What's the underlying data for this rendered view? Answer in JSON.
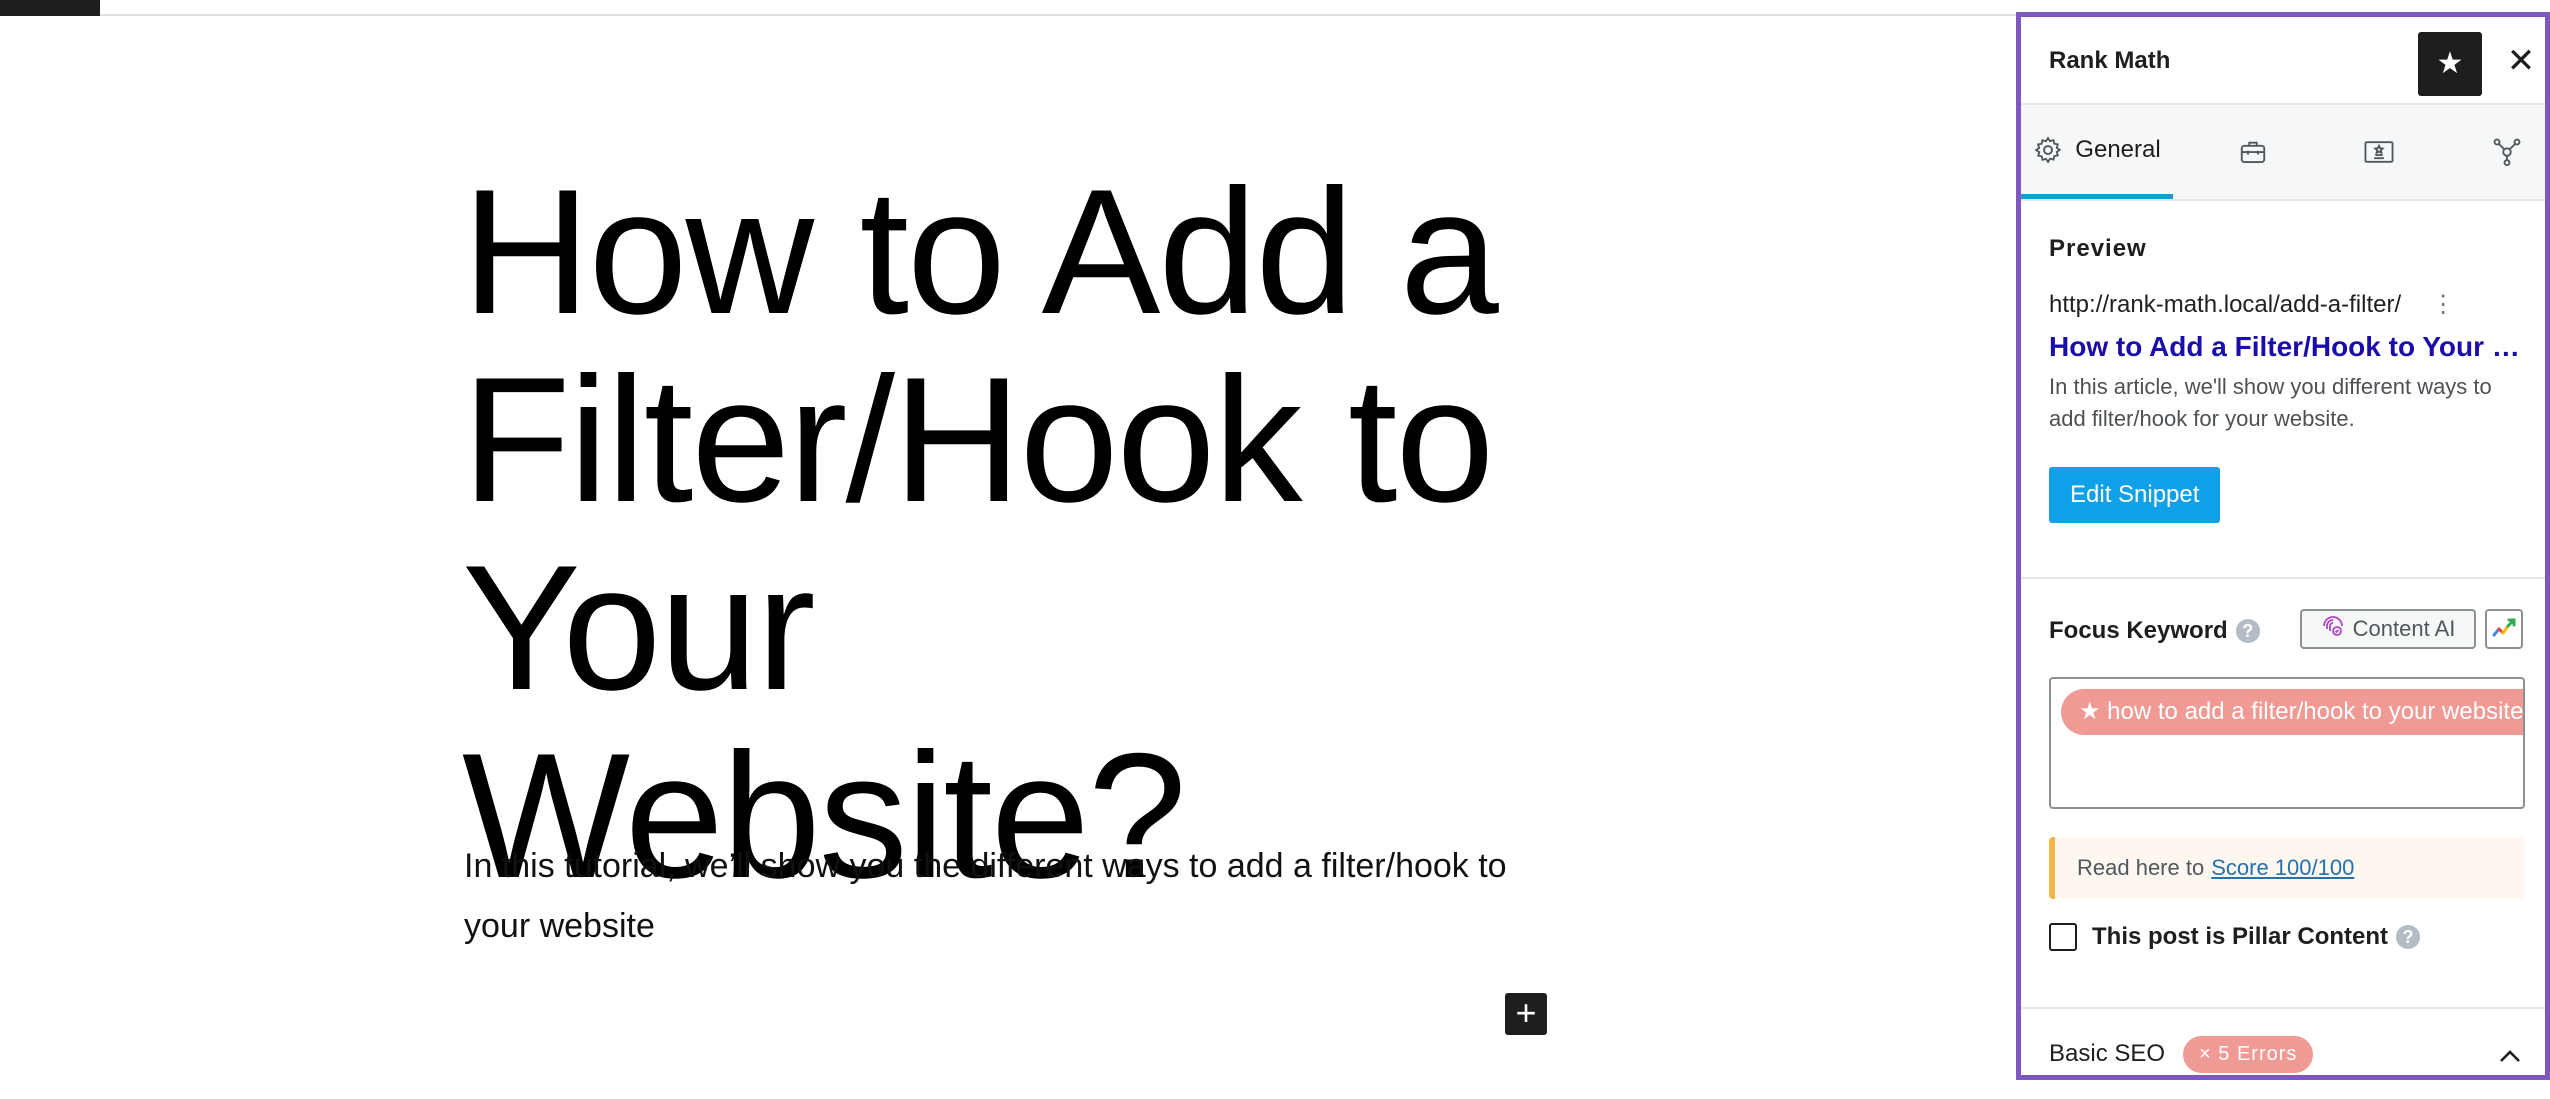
{
  "editor": {
    "post_title": "How to Add a Filter/Hook to Your Website?",
    "paragraph": "In this tutorial, we’ll show you the different ways to add a filter/hook to your website",
    "inserter_label": "+"
  },
  "sidebar": {
    "title": "Rank Math",
    "pin_icon": "★",
    "close_icon": "✕",
    "tabs": [
      {
        "label": "General",
        "icon": "gear-icon",
        "active": true
      },
      {
        "label": "",
        "icon": "toolbox-icon",
        "active": false
      },
      {
        "label": "",
        "icon": "certificate-icon",
        "active": false
      },
      {
        "label": "",
        "icon": "schema-nodes-icon",
        "active": false
      }
    ],
    "preview": {
      "heading": "Preview",
      "url": "http://rank-math.local/add-a-filter/",
      "title": "How to Add a Filter/Hook to Your Website?",
      "description": "In this article, we'll show you different ways to add filter/hook for your website.",
      "edit_snippet_label": "Edit Snippet"
    },
    "focus_keyword": {
      "label": "Focus Keyword",
      "help_icon": "?",
      "content_ai_label": "Content AI",
      "keyword": "★ how to add a filter/hook to your website"
    },
    "notice": {
      "text": "Read here to",
      "link": "Score 100/100"
    },
    "pillar": {
      "label": "This post is Pillar Content",
      "checked": false,
      "help_icon": "?"
    },
    "basic_seo": {
      "label": "Basic SEO",
      "errors_badge": "× 5 Errors",
      "chevron": "^"
    }
  },
  "colors": {
    "accent": "#1b9ad6",
    "panel_border": "#7e57c2",
    "link_title": "#1a0dab",
    "button": "#10a0e8",
    "error_badge": "#ef9a94",
    "notice_border": "#f0b849"
  }
}
